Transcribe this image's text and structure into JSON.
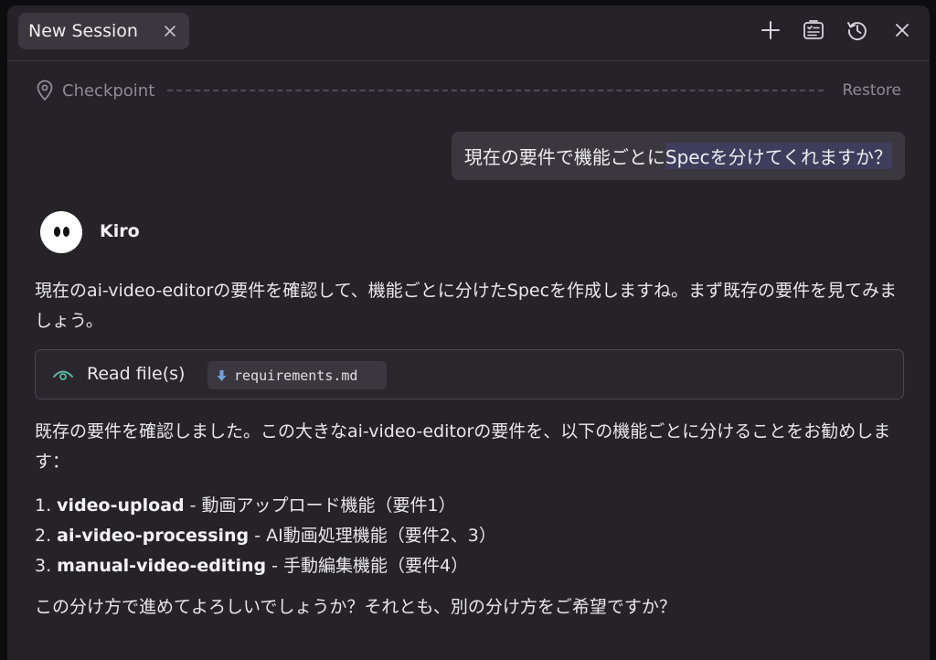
{
  "tab": {
    "title": "New Session"
  },
  "toolbar": {
    "new_icon": "plus-icon",
    "tasks_icon": "checklist-icon",
    "history_icon": "history-icon",
    "close_icon": "close-icon"
  },
  "checkpoint": {
    "label": "Checkpoint",
    "restore_label": "Restore"
  },
  "user_message": {
    "before": "現在の要件で機能ごとに",
    "highlight": "Specを分けてくれますか？"
  },
  "assistant": {
    "name": "Kiro",
    "intro": "現在のai-video-editorの要件を確認して、機能ごとに分けたSpecを作成しますね。まず既存の要件を見てみましょう。",
    "tool": {
      "label": "Read file(s)",
      "file": "requirements.md"
    },
    "summary": "既存の要件を確認しました。この大きなai-video-editorの要件を、以下の機能ごとに分けることをお勧めします：",
    "items": [
      {
        "num": "1. ",
        "name": "video-upload",
        "desc": " - 動画アップロード機能（要件1）"
      },
      {
        "num": "2. ",
        "name": "ai-video-processing",
        "desc": " - AI動画処理機能（要件2、3）"
      },
      {
        "num": "3. ",
        "name": "manual-video-editing",
        "desc": " - 手動編集機能（要件4）"
      }
    ],
    "question": "この分け方で進めてよろしいでしょうか？それとも、別の分け方をご希望ですか？"
  },
  "colors": {
    "panel": "#252328",
    "chip": "#3a383e",
    "accent": "#5fb8a0",
    "highlight": "#3f3c5c"
  }
}
